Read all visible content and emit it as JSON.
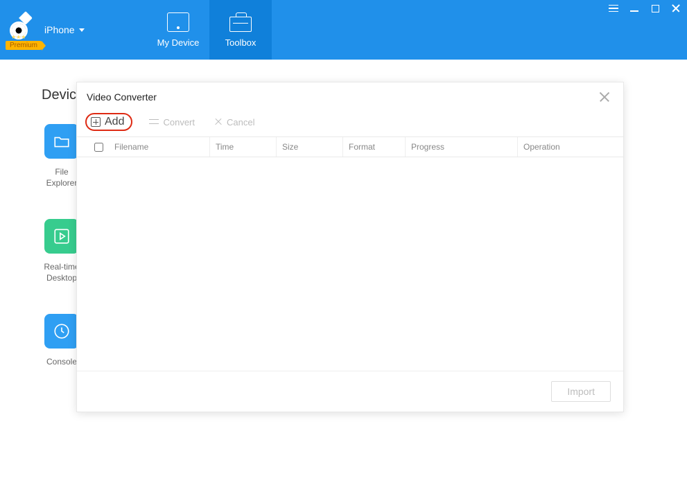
{
  "header": {
    "device": "iPhone",
    "premium": "Premium",
    "tabs": {
      "my_device": "My Device",
      "toolbox": "Toolbox"
    }
  },
  "body": {
    "section_title": "Device",
    "tiles": {
      "file_explorer": "File\nExplorer",
      "realtime_desktop": "Real-time\nDesktop",
      "console": "Console"
    }
  },
  "modal": {
    "title": "Video Converter",
    "toolbar": {
      "add": "Add",
      "convert": "Convert",
      "cancel": "Cancel"
    },
    "columns": {
      "filename": "Filename",
      "time": "Time",
      "size": "Size",
      "format": "Format",
      "progress": "Progress",
      "operation": "Operation"
    },
    "import": "Import"
  }
}
